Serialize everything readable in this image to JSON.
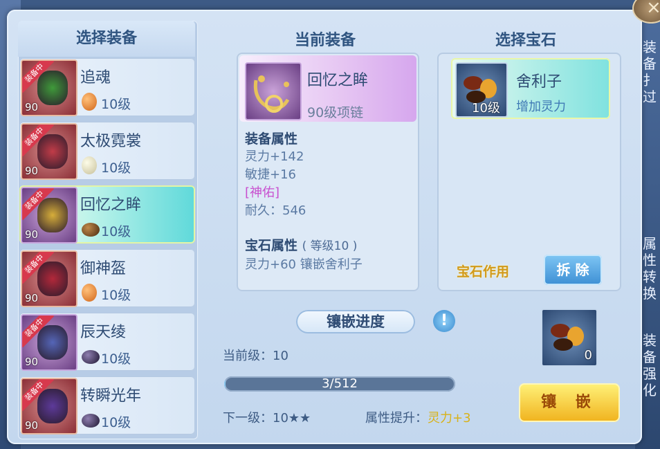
{
  "left": {
    "title": "选择装备",
    "items": [
      {
        "name": "追魂",
        "level": "90",
        "ribbon": "装备中",
        "gem_level": "10级",
        "gem": "orange"
      },
      {
        "name": "太极霓裳",
        "level": "90",
        "ribbon": "装备中",
        "gem_level": "10级",
        "gem": "white"
      },
      {
        "name": "回忆之眸",
        "level": "90",
        "ribbon": "装备中",
        "gem_level": "10级",
        "gem": "brown",
        "selected": true
      },
      {
        "name": "御神盔",
        "level": "90",
        "ribbon": "装备中",
        "gem_level": "10级",
        "gem": "orange"
      },
      {
        "name": "辰天绫",
        "level": "90",
        "ribbon": "装备中",
        "gem_level": "10级",
        "gem": "purple"
      },
      {
        "name": "转瞬光年",
        "level": "90",
        "ribbon": "装备中",
        "gem_level": "10级",
        "gem": "purple"
      }
    ]
  },
  "equip": {
    "title": "当前装备",
    "name": "回忆之眸",
    "sub": "90级项链",
    "attr_head": "装备属性",
    "attrs": [
      "灵力+142",
      "敏捷+16",
      "[神佑]",
      "耐久：546"
    ],
    "gem_head": "宝石属性",
    "gem_head_note": "( 等级10 )",
    "gem_attr": "灵力+60 镶嵌舍利子"
  },
  "gems": {
    "title": "选择宝石",
    "card": {
      "level": "10级",
      "name": "舍利子",
      "desc": "增加灵力"
    },
    "func_label": "宝石作用",
    "remove_label": "拆 除"
  },
  "progress": {
    "title": "镶嵌进度",
    "info_icon": "!",
    "current_level": "当前级：10",
    "bar_text": "3/512",
    "fraction": 0.006,
    "next_level": "下一级：10★★",
    "attr_up_label": "属性提升：",
    "attr_up_value": "灵力+3"
  },
  "material": {
    "count": "0"
  },
  "inlay_label": "镶 嵌",
  "side_text": {
    "top": "装备扌过",
    "mid": "属性转换",
    "bot": "装备强化"
  },
  "close_icon": "×"
}
